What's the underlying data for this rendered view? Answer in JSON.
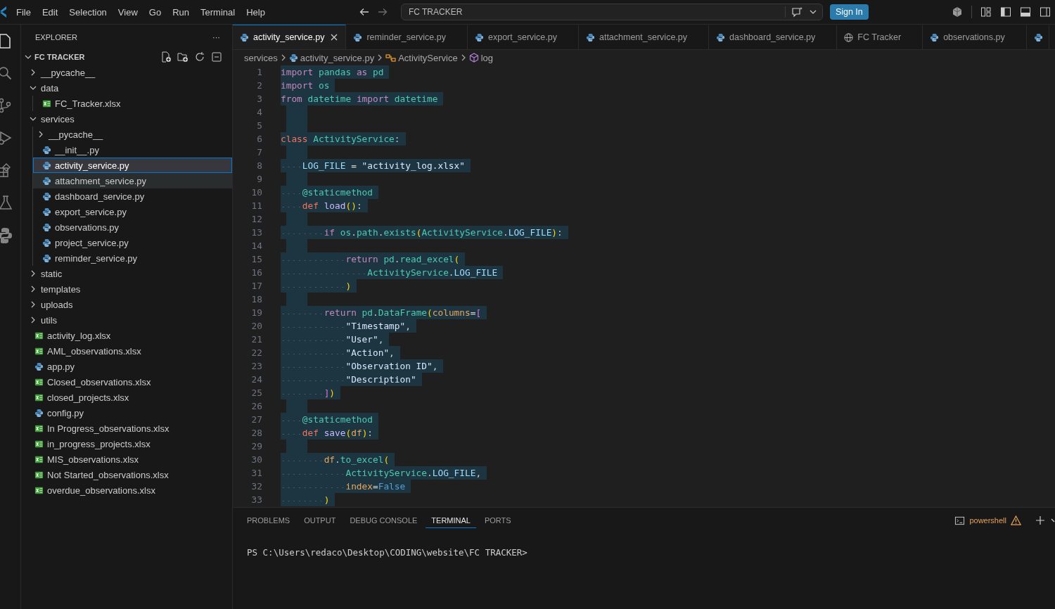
{
  "menu": [
    "File",
    "Edit",
    "Selection",
    "View",
    "Go",
    "Run",
    "Terminal",
    "Help"
  ],
  "command_center": {
    "value": "FC TRACKER"
  },
  "sign_in": "Sign In",
  "explorer": {
    "title": "EXPLORER",
    "more": "···",
    "root": "FC TRACKER",
    "expanded": true,
    "items": [
      {
        "name": "__pycache__",
        "kind": "folder",
        "expanded": false,
        "selected": false,
        "highlighted": false
      },
      {
        "name": "data",
        "kind": "folder",
        "expanded": true,
        "selected": false,
        "highlighted": false,
        "children": [
          {
            "name": "FC_Tracker.xlsx",
            "kind": "excel",
            "selected": false,
            "highlighted": false
          }
        ]
      },
      {
        "name": "services",
        "kind": "folder",
        "expanded": true,
        "selected": false,
        "highlighted": false,
        "children": [
          {
            "name": "__pycache__",
            "kind": "folder",
            "expanded": false,
            "selected": false,
            "highlighted": false
          },
          {
            "name": "__init__.py",
            "kind": "python",
            "selected": false,
            "highlighted": false
          },
          {
            "name": "activity_service.py",
            "kind": "python",
            "selected": true,
            "highlighted": false
          },
          {
            "name": "attachment_service.py",
            "kind": "python",
            "selected": false,
            "highlighted": true
          },
          {
            "name": "dashboard_service.py",
            "kind": "python",
            "selected": false,
            "highlighted": false
          },
          {
            "name": "export_service.py",
            "kind": "python",
            "selected": false,
            "highlighted": false
          },
          {
            "name": "observations.py",
            "kind": "python",
            "selected": false,
            "highlighted": false
          },
          {
            "name": "project_service.py",
            "kind": "python",
            "selected": false,
            "highlighted": false
          },
          {
            "name": "reminder_service.py",
            "kind": "python",
            "selected": false,
            "highlighted": false
          }
        ]
      },
      {
        "name": "static",
        "kind": "folder",
        "expanded": false,
        "selected": false,
        "highlighted": false
      },
      {
        "name": "templates",
        "kind": "folder",
        "expanded": false,
        "selected": false,
        "highlighted": false
      },
      {
        "name": "uploads",
        "kind": "folder",
        "expanded": false,
        "selected": false,
        "highlighted": false
      },
      {
        "name": "utils",
        "kind": "folder",
        "expanded": false,
        "selected": false,
        "highlighted": false
      },
      {
        "name": "activity_log.xlsx",
        "kind": "excel",
        "selected": false,
        "highlighted": false
      },
      {
        "name": "AML_observations.xlsx",
        "kind": "excel",
        "selected": false,
        "highlighted": false
      },
      {
        "name": "app.py",
        "kind": "python",
        "selected": false,
        "highlighted": false
      },
      {
        "name": "Closed_observations.xlsx",
        "kind": "excel",
        "selected": false,
        "highlighted": false
      },
      {
        "name": "closed_projects.xlsx",
        "kind": "excel",
        "selected": false,
        "highlighted": false
      },
      {
        "name": "config.py",
        "kind": "python",
        "selected": false,
        "highlighted": false
      },
      {
        "name": "In Progress_observations.xlsx",
        "kind": "excel",
        "selected": false,
        "highlighted": false
      },
      {
        "name": "in_progress_projects.xlsx",
        "kind": "excel",
        "selected": false,
        "highlighted": false
      },
      {
        "name": "MIS_observations.xlsx",
        "kind": "excel",
        "selected": false,
        "highlighted": false
      },
      {
        "name": "Not Started_observations.xlsx",
        "kind": "excel",
        "selected": false,
        "highlighted": false
      },
      {
        "name": "overdue_observations.xlsx",
        "kind": "excel",
        "selected": false,
        "highlighted": false
      }
    ]
  },
  "tabs": [
    {
      "label": "activity_service.py",
      "kind": "python",
      "selected": true
    },
    {
      "label": "reminder_service.py",
      "kind": "python",
      "selected": false
    },
    {
      "label": "export_service.py",
      "kind": "python",
      "selected": false
    },
    {
      "label": "attachment_service.py",
      "kind": "python",
      "selected": false
    },
    {
      "label": "dashboard_service.py",
      "kind": "python",
      "selected": false
    },
    {
      "label": "FC Tracker",
      "kind": "web",
      "selected": false
    },
    {
      "label": "observations.py",
      "kind": "python",
      "selected": false
    },
    {
      "kind": "python",
      "selected": false
    }
  ],
  "breadcrumb": [
    {
      "kind": "folder",
      "text": "services"
    },
    {
      "kind": "python",
      "text": "activity_service.py"
    },
    {
      "kind": "class",
      "text": "ActivityService"
    },
    {
      "kind": "member",
      "text": "log"
    }
  ],
  "code": [
    {
      "number": "1",
      "tokens": [
        {
          "kind": "kw",
          "text": "import "
        },
        {
          "kind": "mod",
          "text": "pandas "
        },
        {
          "kind": "kw",
          "text": "as "
        },
        {
          "kind": "mod",
          "text": "pd"
        }
      ]
    },
    {
      "number": "2",
      "tokens": [
        {
          "kind": "kw",
          "text": "import "
        },
        {
          "kind": "mod",
          "text": "os"
        }
      ]
    },
    {
      "number": "3",
      "tokens": [
        {
          "kind": "kw",
          "text": "from "
        },
        {
          "kind": "mod",
          "text": "datetime "
        },
        {
          "kind": "kw",
          "text": "import "
        },
        {
          "kind": "mod",
          "text": "datetime"
        }
      ]
    },
    {
      "number": "4"
    },
    {
      "number": "5"
    },
    {
      "number": "6",
      "tokens": [
        {
          "kind": "storage",
          "text": "class "
        },
        {
          "kind": "mod",
          "text": "ActivityService"
        },
        {
          "kind": "punc",
          "text": ":"
        }
      ]
    },
    {
      "number": "7"
    },
    {
      "number": "8",
      "tokens": [
        {
          "kind": "var",
          "text": "    LOG_FILE"
        },
        {
          "kind": "punc",
          "text": " = "
        },
        {
          "kind": "str",
          "text": "\"activity_log.xlsx\""
        }
      ]
    },
    {
      "number": "9"
    },
    {
      "number": "10",
      "tokens": [
        {
          "kind": "deco",
          "text": "    @staticmethod"
        }
      ]
    },
    {
      "number": "11",
      "tokens": [
        {
          "kind": "storage",
          "text": "    def "
        },
        {
          "kind": "fn",
          "text": "load"
        },
        {
          "kind": "paren",
          "text": "()"
        },
        {
          "kind": "punc",
          "text": ":"
        }
      ]
    },
    {
      "number": "12"
    },
    {
      "number": "13",
      "tokens": [
        {
          "kind": "kw",
          "text": "        if "
        },
        {
          "kind": "mod",
          "text": "os"
        },
        {
          "kind": "punc",
          "text": "."
        },
        {
          "kind": "method",
          "text": "path"
        },
        {
          "kind": "punc",
          "text": "."
        },
        {
          "kind": "method",
          "text": "exists"
        },
        {
          "kind": "paren",
          "text": "("
        },
        {
          "kind": "mod",
          "text": "ActivityService"
        },
        {
          "kind": "punc",
          "text": "."
        },
        {
          "kind": "var",
          "text": "LOG_FILE"
        },
        {
          "kind": "paren",
          "text": ")"
        },
        {
          "kind": "punc",
          "text": ":"
        }
      ]
    },
    {
      "number": "14"
    },
    {
      "number": "15",
      "tokens": [
        {
          "kind": "kw",
          "text": "            return "
        },
        {
          "kind": "mod",
          "text": "pd"
        },
        {
          "kind": "punc",
          "text": "."
        },
        {
          "kind": "method",
          "text": "read_excel"
        },
        {
          "kind": "paren",
          "text": "("
        }
      ]
    },
    {
      "number": "16",
      "tokens": [
        {
          "kind": "mod",
          "text": "                ActivityService"
        },
        {
          "kind": "punc",
          "text": "."
        },
        {
          "kind": "var",
          "text": "LOG_FILE"
        }
      ]
    },
    {
      "number": "17",
      "tokens": [
        {
          "kind": "paren",
          "text": "            )"
        }
      ]
    },
    {
      "number": "18"
    },
    {
      "number": "19",
      "tokens": [
        {
          "kind": "kw",
          "text": "        return "
        },
        {
          "kind": "mod",
          "text": "pd"
        },
        {
          "kind": "punc",
          "text": "."
        },
        {
          "kind": "method",
          "text": "DataFrame"
        },
        {
          "kind": "paren",
          "text": "("
        },
        {
          "kind": "param",
          "text": "columns"
        },
        {
          "kind": "punc",
          "text": "="
        },
        {
          "kind": "bracket",
          "text": "["
        }
      ]
    },
    {
      "number": "20",
      "tokens": [
        {
          "kind": "str",
          "text": "            \"Timestamp\""
        },
        {
          "kind": "punc",
          "text": ","
        }
      ]
    },
    {
      "number": "21",
      "tokens": [
        {
          "kind": "str",
          "text": "            \"User\""
        },
        {
          "kind": "punc",
          "text": ","
        }
      ]
    },
    {
      "number": "22",
      "tokens": [
        {
          "kind": "str",
          "text": "            \"Action\""
        },
        {
          "kind": "punc",
          "text": ","
        }
      ]
    },
    {
      "number": "23",
      "tokens": [
        {
          "kind": "str",
          "text": "            \"Observation ID\""
        },
        {
          "kind": "punc",
          "text": ","
        }
      ]
    },
    {
      "number": "24",
      "tokens": [
        {
          "kind": "str",
          "text": "            \"Description\""
        }
      ]
    },
    {
      "number": "25",
      "tokens": [
        {
          "kind": "bracket",
          "text": "        ]"
        },
        {
          "kind": "paren",
          "text": ")"
        }
      ]
    },
    {
      "number": "26"
    },
    {
      "number": "27",
      "tokens": [
        {
          "kind": "deco",
          "text": "    @staticmethod"
        }
      ]
    },
    {
      "number": "28",
      "tokens": [
        {
          "kind": "storage",
          "text": "    def "
        },
        {
          "kind": "fn",
          "text": "save"
        },
        {
          "kind": "paren",
          "text": "("
        },
        {
          "kind": "param",
          "text": "df"
        },
        {
          "kind": "paren",
          "text": ")"
        },
        {
          "kind": "punc",
          "text": ":"
        }
      ]
    },
    {
      "number": "29"
    },
    {
      "number": "30",
      "tokens": [
        {
          "kind": "param",
          "text": "        df"
        },
        {
          "kind": "punc",
          "text": "."
        },
        {
          "kind": "method",
          "text": "to_excel"
        },
        {
          "kind": "paren",
          "text": "("
        }
      ]
    },
    {
      "number": "31",
      "tokens": [
        {
          "kind": "mod",
          "text": "            ActivityService"
        },
        {
          "kind": "punc",
          "text": "."
        },
        {
          "kind": "var",
          "text": "LOG_FILE"
        },
        {
          "kind": "punc",
          "text": ","
        }
      ]
    },
    {
      "number": "32",
      "tokens": [
        {
          "kind": "param",
          "text": "            index"
        },
        {
          "kind": "punc",
          "text": "="
        },
        {
          "kind": "const",
          "text": "False"
        }
      ]
    },
    {
      "number": "33",
      "tokens": [
        {
          "kind": "paren",
          "text": "        )"
        }
      ]
    }
  ],
  "panel": {
    "tabs": [
      {
        "label": "PROBLEMS",
        "selected": false
      },
      {
        "label": "OUTPUT",
        "selected": false
      },
      {
        "label": "DEBUG CONSOLE",
        "selected": false
      },
      {
        "label": "TERMINAL",
        "selected": true
      },
      {
        "label": "PORTS",
        "selected": false
      }
    ],
    "shell": "powershell",
    "prompt": "PS C:\\Users\\redaco\\Desktop\\CODING\\website\\FC TRACKER>"
  }
}
